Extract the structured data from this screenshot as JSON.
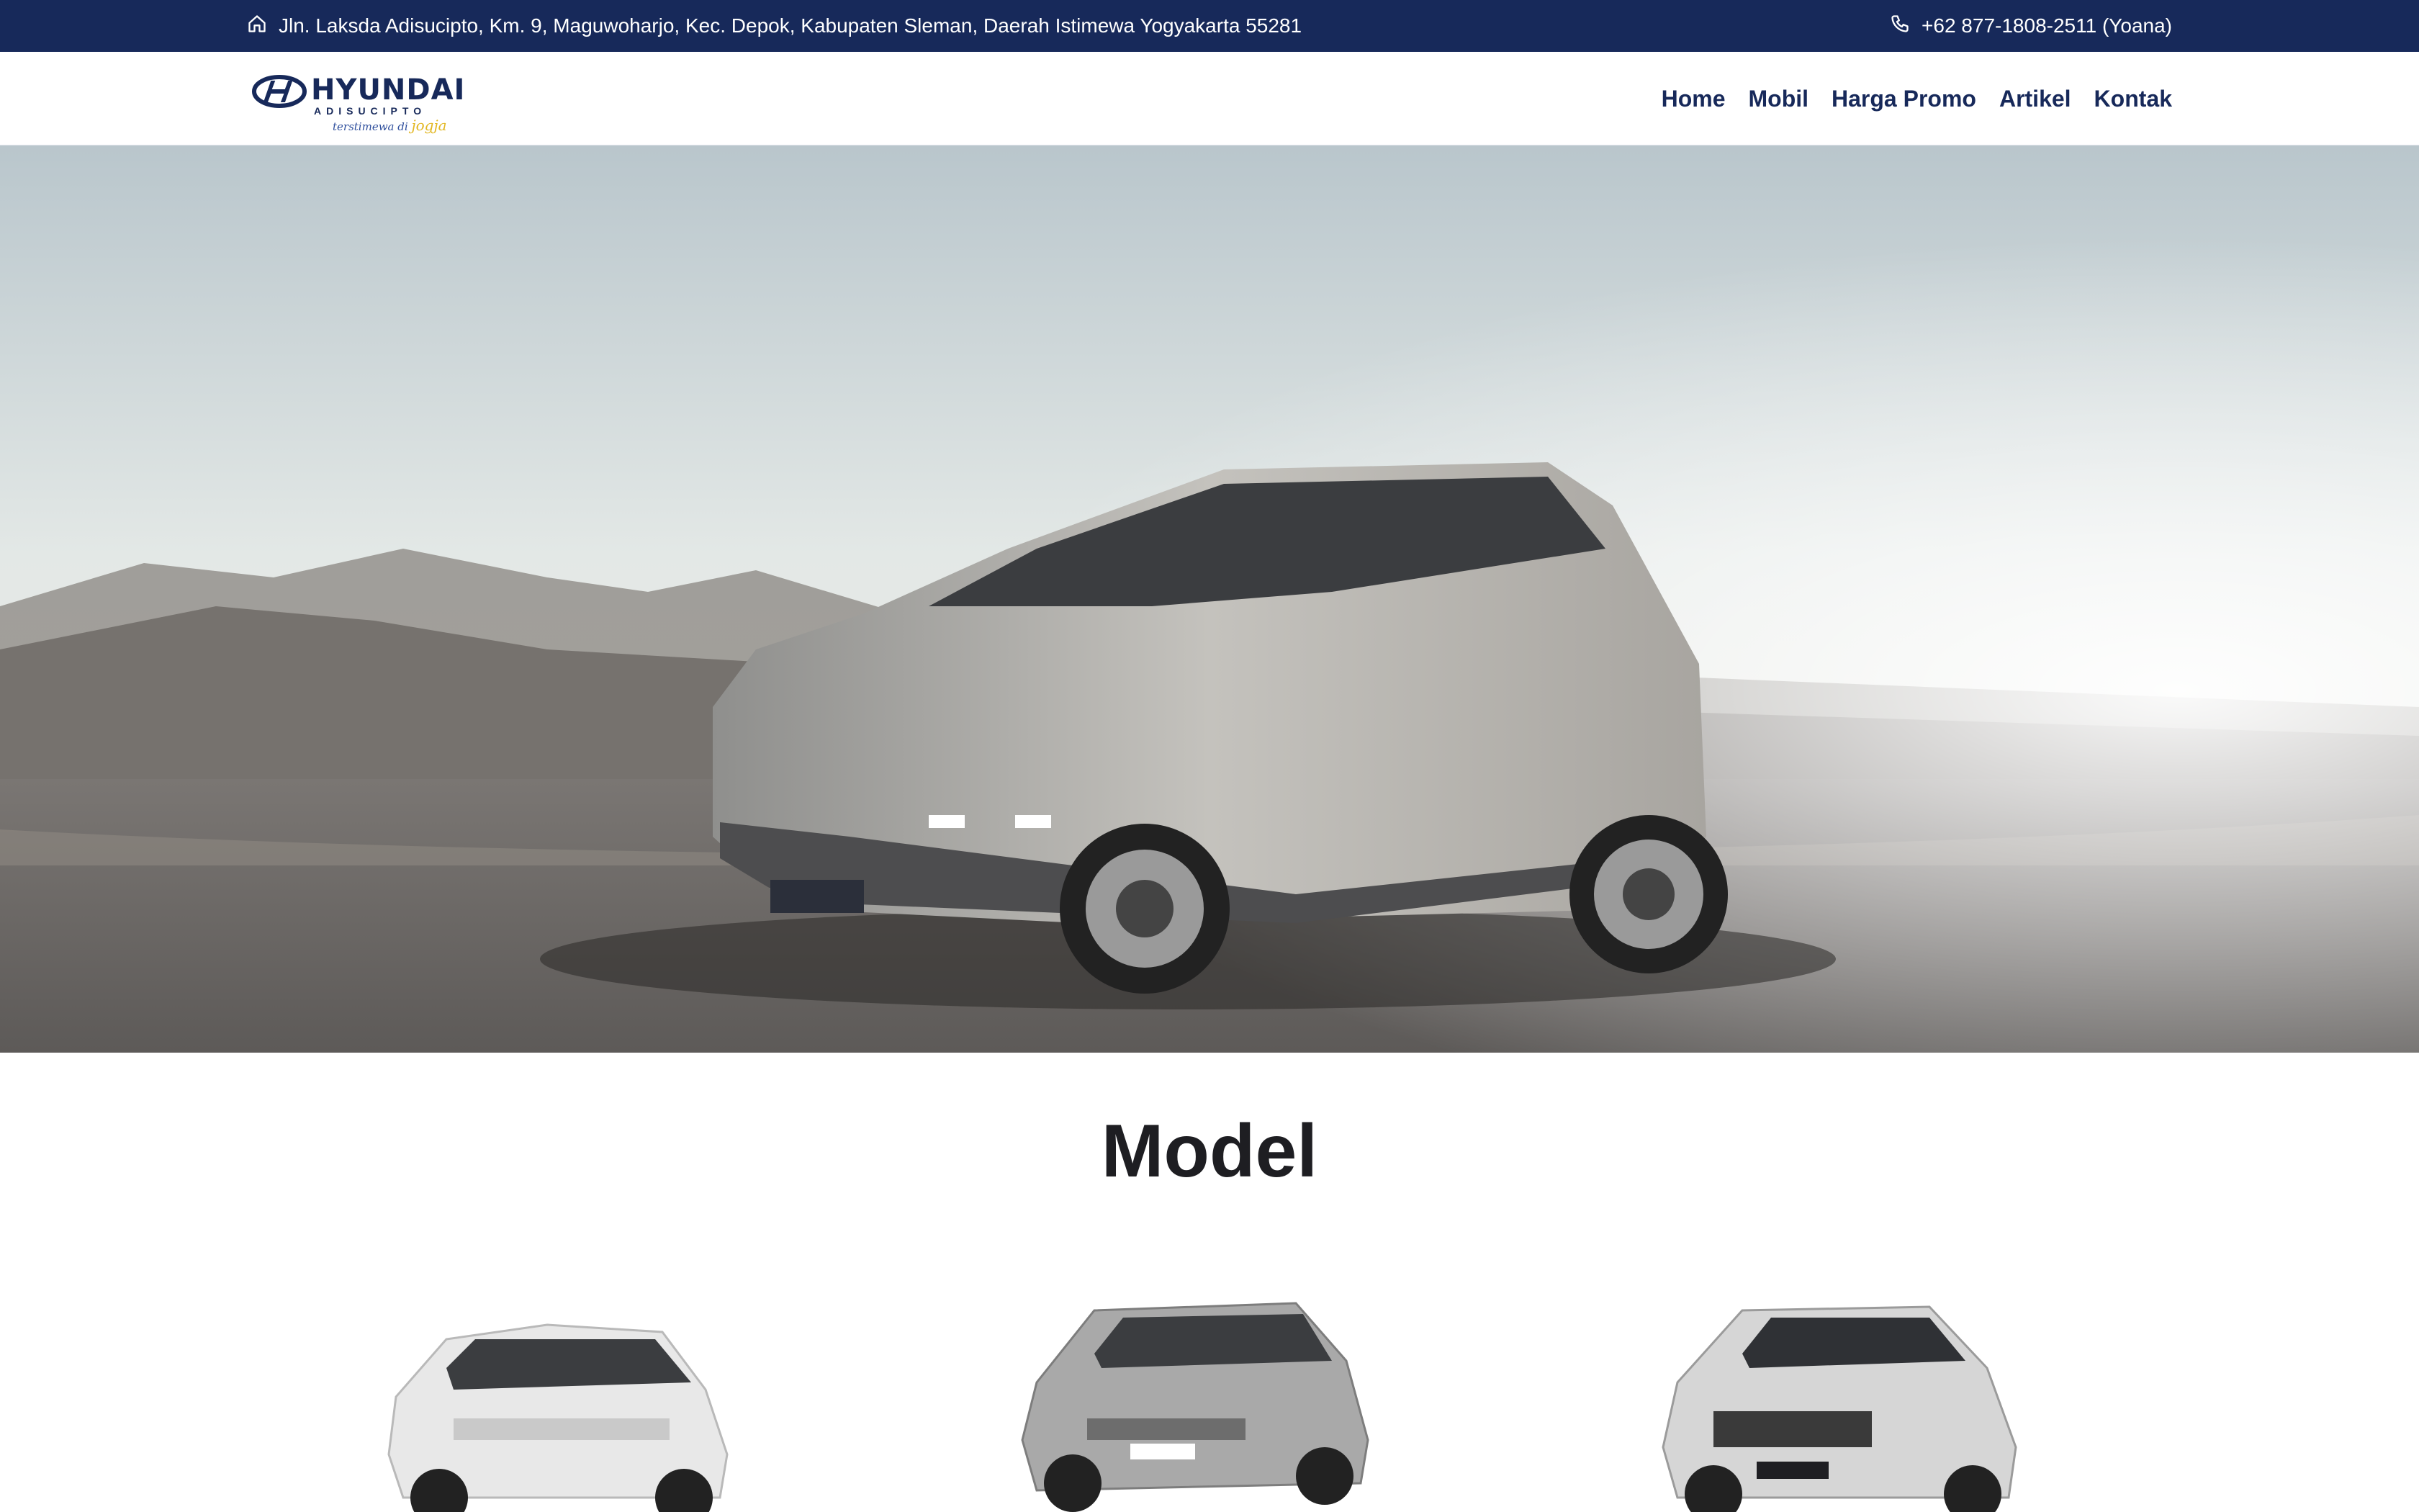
{
  "topbar": {
    "address": "Jln. Laksda Adisucipto, Km. 9, Maguwoharjo, Kec. Depok, Kabupaten Sleman, Daerah Istimewa Yogyakarta 55281",
    "phone": "+62 877-1808-2511 (Yoana)",
    "address_icon": "home-icon",
    "phone_icon": "phone-icon"
  },
  "brand": {
    "name": "HYUNDAI",
    "sub": "ADISUCIPTO",
    "tagline_prefix": "terstimewa di",
    "tagline_accent": "jogja"
  },
  "nav": {
    "items": [
      {
        "label": "Home"
      },
      {
        "label": "Mobil"
      },
      {
        "label": "Harga Promo"
      },
      {
        "label": "Artikel"
      },
      {
        "label": "Kontak"
      }
    ]
  },
  "models": {
    "title": "Model"
  },
  "colors": {
    "primary": "#17295a",
    "accent": "#e2b722",
    "text": "#1e1e22"
  }
}
